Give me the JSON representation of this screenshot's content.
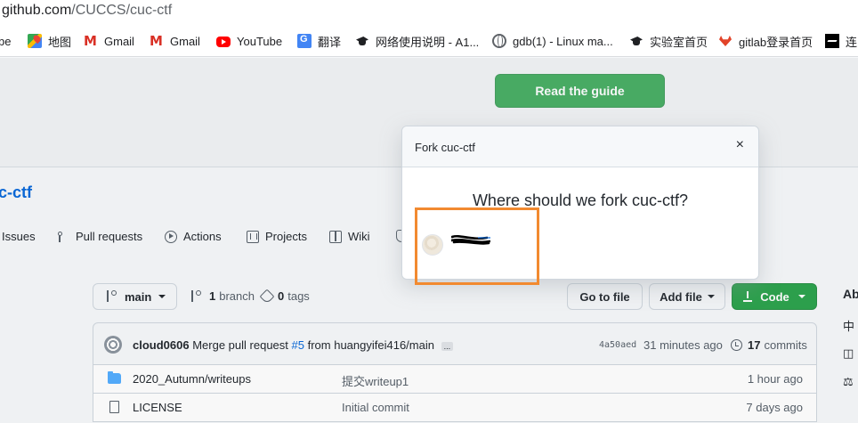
{
  "browser": {
    "url_host": "github.com",
    "url_path": "/CUCCS/cuc-ctf"
  },
  "bookmarks": [
    {
      "label": "be",
      "icon": "youtube-icon"
    },
    {
      "label": "地图",
      "icon": "maps-icon"
    },
    {
      "label": "Gmail",
      "icon": "gmail-icon"
    },
    {
      "label": "Gmail",
      "icon": "gmail-icon"
    },
    {
      "label": "YouTube",
      "icon": "youtube-icon"
    },
    {
      "label": "翻译",
      "icon": "translate-icon"
    },
    {
      "label": "网络使用说明 - A1...",
      "icon": "graduation-cap-icon"
    },
    {
      "label": "gdb(1) - Linux ma...",
      "icon": "globe-icon"
    },
    {
      "label": "实验室首页",
      "icon": "graduation-cap-icon"
    },
    {
      "label": "gitlab登录首页",
      "icon": "gitlab-icon"
    },
    {
      "label": "连",
      "icon": "bookmark-dark-icon"
    }
  ],
  "hero": {
    "guide_button": "Read the guide"
  },
  "repo": {
    "title": "c-ctf"
  },
  "nav": {
    "issues": "Issues",
    "pull_requests": "Pull requests",
    "actions": "Actions",
    "projects": "Projects",
    "wiki": "Wiki"
  },
  "toolbar": {
    "branch": "main",
    "branches_count": "1",
    "branches_label": "branch",
    "tags_count": "0",
    "tags_label": "tags",
    "go_to_file": "Go to file",
    "add_file": "Add file",
    "code": "Code"
  },
  "sidebar": {
    "about": "Ab",
    "glyph1": "中",
    "glyph2": "◫",
    "glyph3": "⚖"
  },
  "commit": {
    "author": "cloud0606",
    "message_prefix": "Merge pull request",
    "pr": "#5",
    "message_suffix": "from huangyifei416/main",
    "ellipsis": "...",
    "sha": "4a50aed",
    "time": "31 minutes ago",
    "count": "17",
    "count_label": "commits"
  },
  "files": [
    {
      "name": "2020_Autumn/writeups",
      "message": "提交writeup1",
      "age": "1 hour ago",
      "type": "folder"
    },
    {
      "name": "LICENSE",
      "message": "Initial commit",
      "age": "7 days ago",
      "type": "file"
    }
  ],
  "modal": {
    "title": "Fork cuc-ctf",
    "close": "×",
    "question": "Where should we fork cuc-ctf?"
  },
  "colors": {
    "highlight": "#f28a30",
    "primary_green": "#2da44e",
    "link_blue": "#0969da"
  }
}
